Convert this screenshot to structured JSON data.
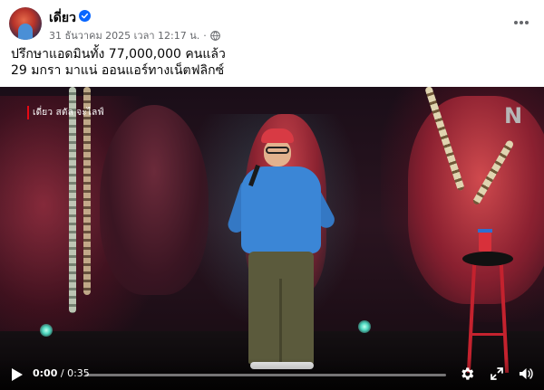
{
  "post": {
    "author": "เดี่ยว",
    "timestamp": "31 ธันวาคม 2025 เวลา 12:17 น.",
    "separator": "·",
    "privacy_icon": "globe-icon",
    "verified_icon": "verified-badge-icon",
    "more_icon": "more-options-icon",
    "caption_lines": [
      "ปรึกษาแอดมินทั้ง 77,000,000 คนแล้ว",
      "29 มกรา มาแน่ ออนแอร์ทางเน็ตฟลิกซ์"
    ]
  },
  "video": {
    "channel_label": "เดี่ยว สตัล จะไลฟ์",
    "brand_logo": "N",
    "current_time": "0:00",
    "time_separator": " / ",
    "duration": "0:35",
    "progress_fraction": 0.0,
    "icons": {
      "play": "play-icon",
      "settings": "gear-icon",
      "fullscreen": "expand-icon",
      "volume": "speaker-icon"
    }
  },
  "colors": {
    "verified_blue": "#0866ff",
    "meta_gray": "#65676b",
    "netflix_red": "#e50914"
  }
}
